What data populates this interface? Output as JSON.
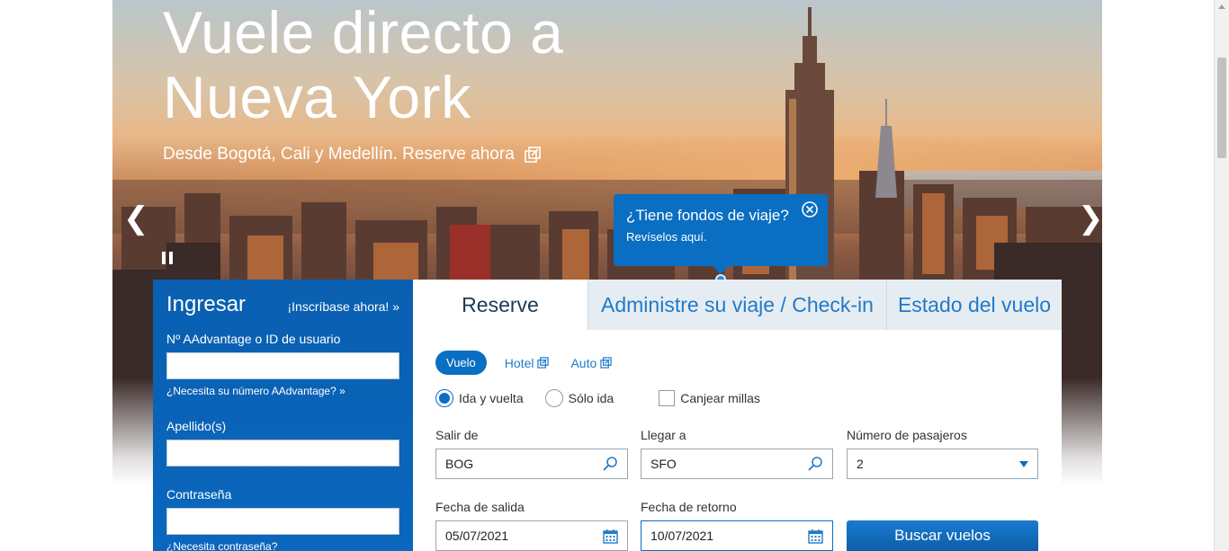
{
  "hero": {
    "title": "Vuele directo a Nueva York",
    "subtitle": "Desde Bogotá, Cali y Medellín. Reserve ahora",
    "prev_arrow": "❮",
    "next_arrow": "❯"
  },
  "tooltip": {
    "title": "¿Tiene fondos de viaje?",
    "subtitle": "Revíselos aquí."
  },
  "login": {
    "title": "Ingresar",
    "join": "¡Inscríbase ahora! »",
    "aadvantage_label": "Nº AAdvantage o ID de usuario",
    "aadvantage_help": "¿Necesita su número AAdvantage? »",
    "lastname_label": "Apellido(s)",
    "password_label": "Contraseña",
    "password_help": "¿Necesita contraseña?"
  },
  "tabs": [
    "Reserve",
    "Administre su viaje / Check-in",
    "Estado del vuelo"
  ],
  "trip_types": {
    "vuelo": "Vuelo",
    "hotel": "Hotel",
    "auto": "Auto"
  },
  "options": {
    "roundtrip": "Ida y vuelta",
    "oneway": "Sólo ida",
    "miles": "Canjear millas"
  },
  "form": {
    "from_label": "Salir de",
    "from_value": "BOG",
    "to_label": "Llegar a",
    "to_value": "SFO",
    "pax_label": "Número de pasajeros",
    "pax_value": "2",
    "depart_label": "Fecha de salida",
    "depart_value": "05/07/2021",
    "return_label": "Fecha de retorno",
    "return_value": "10/07/2021",
    "search_button": "Buscar vuelos"
  },
  "colors": {
    "brand_blue": "#0a6fc2",
    "link_blue": "#1f7ac9"
  }
}
